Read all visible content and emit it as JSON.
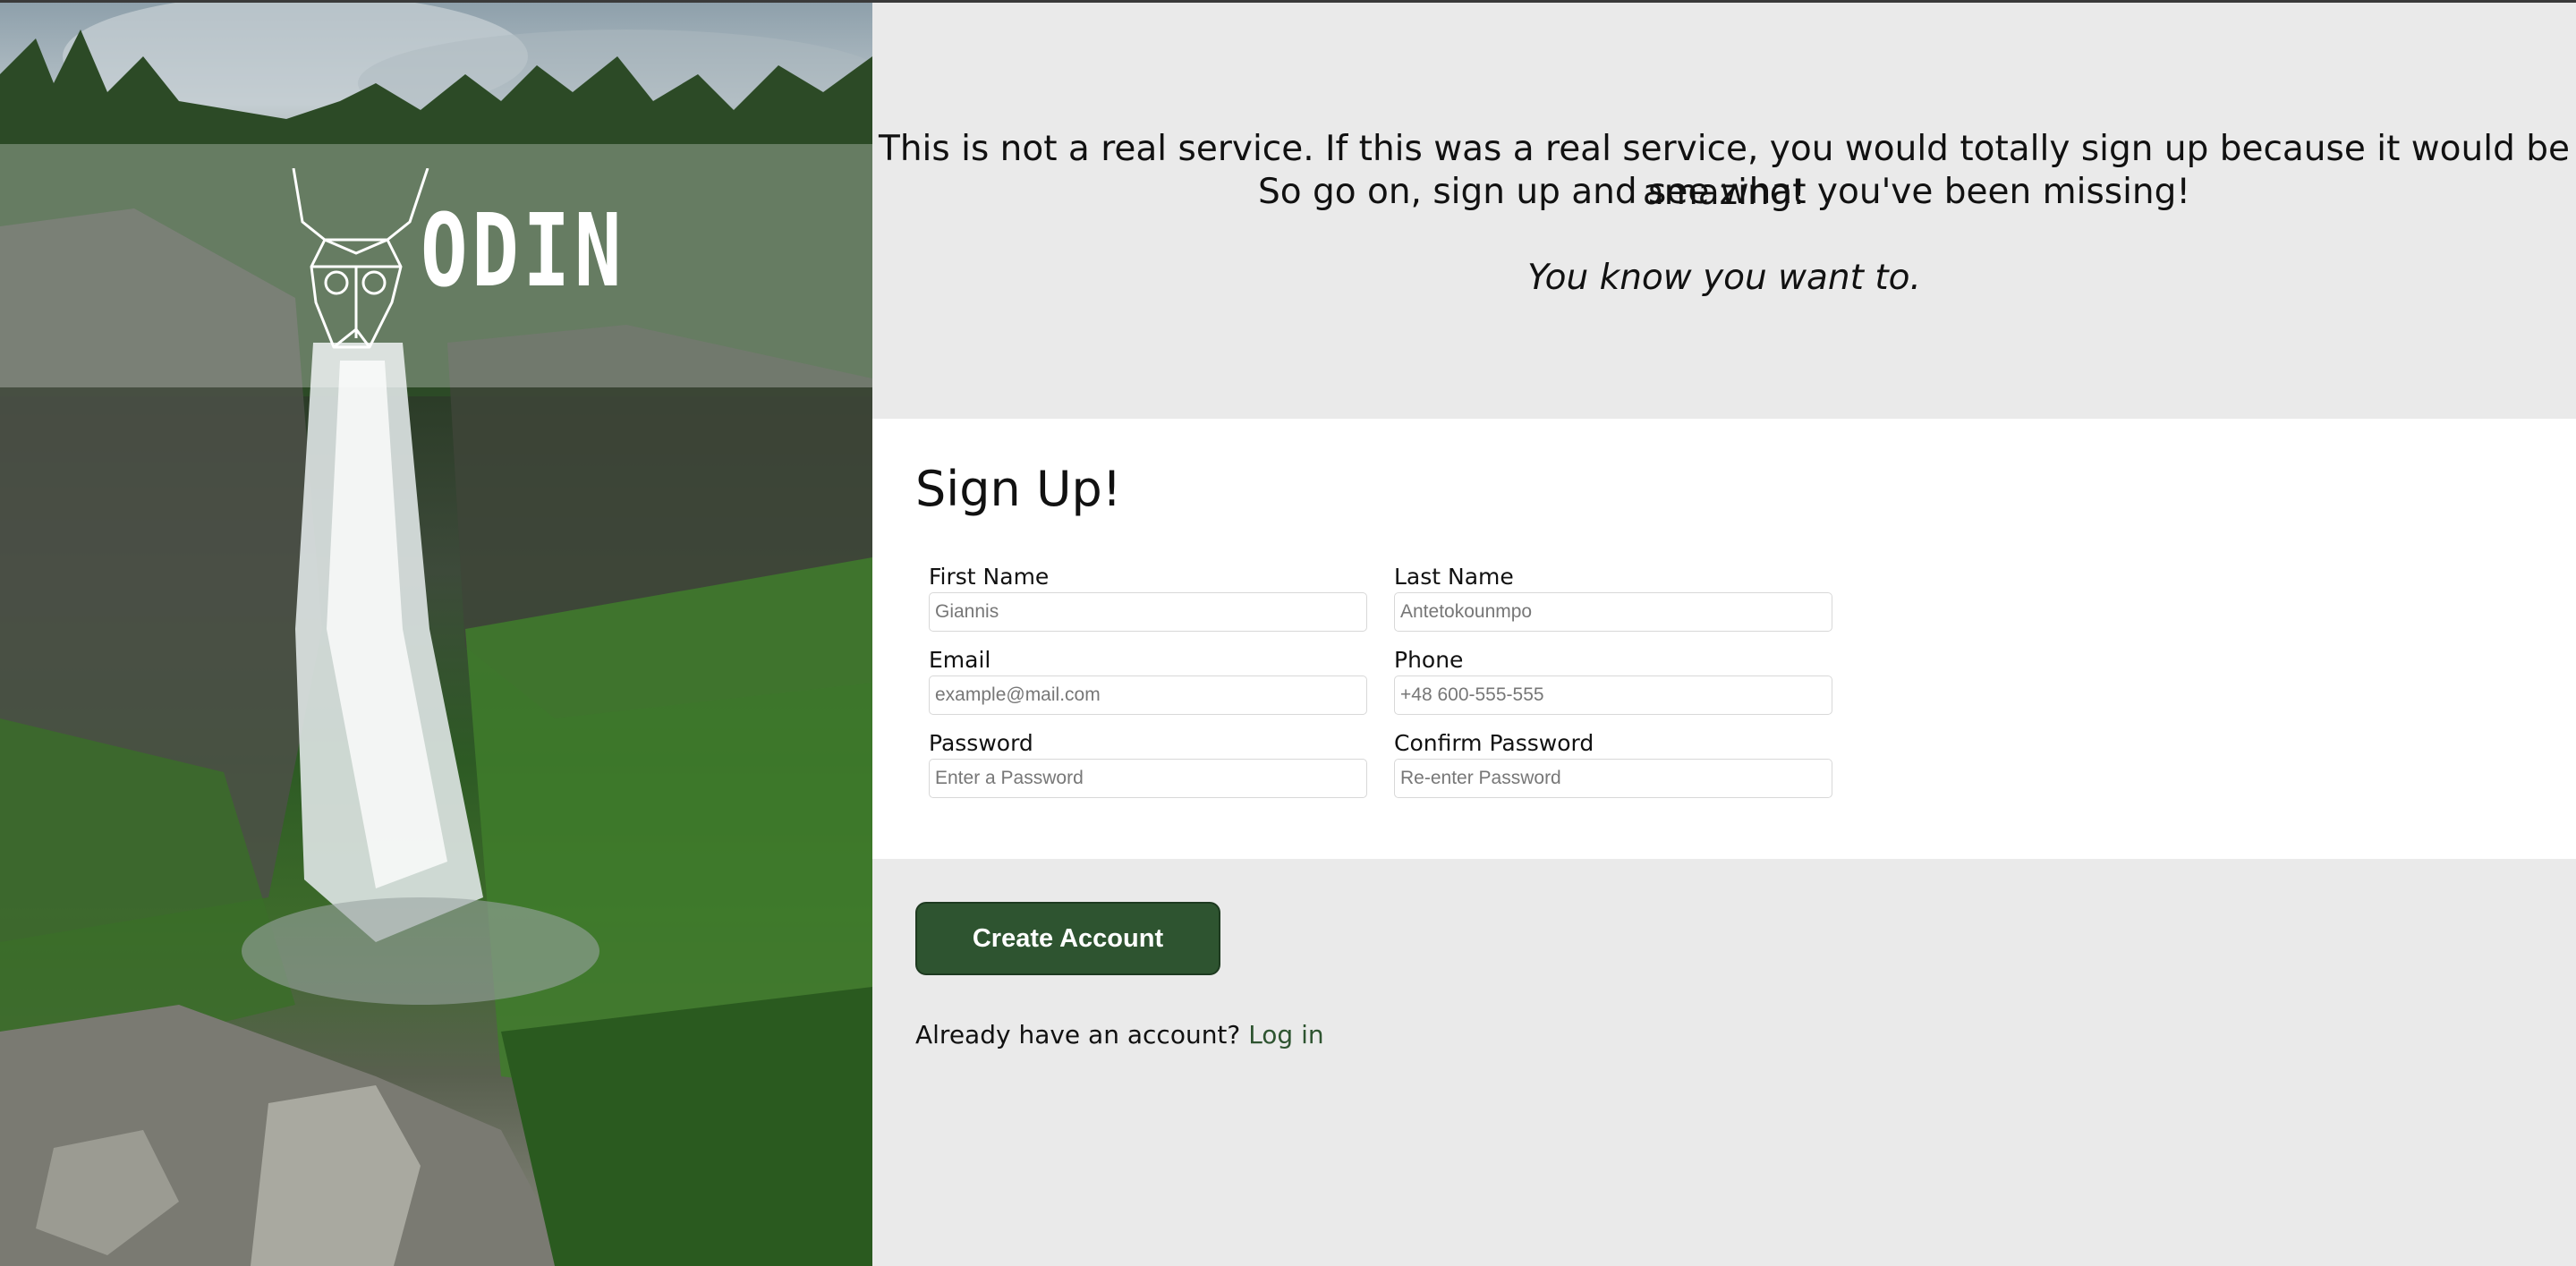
{
  "brand": {
    "name": "ODIN"
  },
  "intro": {
    "line1": "This is not a real service. If this was a real service, you would totally sign up because it would be amazing!",
    "line2": "So go on, sign up and see what you've been missing!",
    "tagline": "You know you want to."
  },
  "form": {
    "title": "Sign Up!",
    "fields": {
      "first_name": {
        "label": "First Name",
        "placeholder": "Giannis"
      },
      "last_name": {
        "label": "Last Name",
        "placeholder": "Antetokounmpo"
      },
      "email": {
        "label": "Email",
        "placeholder": "example@mail.com"
      },
      "phone": {
        "label": "Phone",
        "placeholder": "+48 600-555-555"
      },
      "password": {
        "label": "Password",
        "placeholder": "Enter a Password"
      },
      "confirm_password": {
        "label": "Confirm Password",
        "placeholder": "Re-enter Password"
      }
    }
  },
  "actions": {
    "submit_label": "Create Account",
    "login_prompt": "Already have an account?",
    "login_link": "Log in"
  },
  "colors": {
    "accent": "#2e5430",
    "background": "#eaeaea",
    "card": "#ffffff"
  }
}
